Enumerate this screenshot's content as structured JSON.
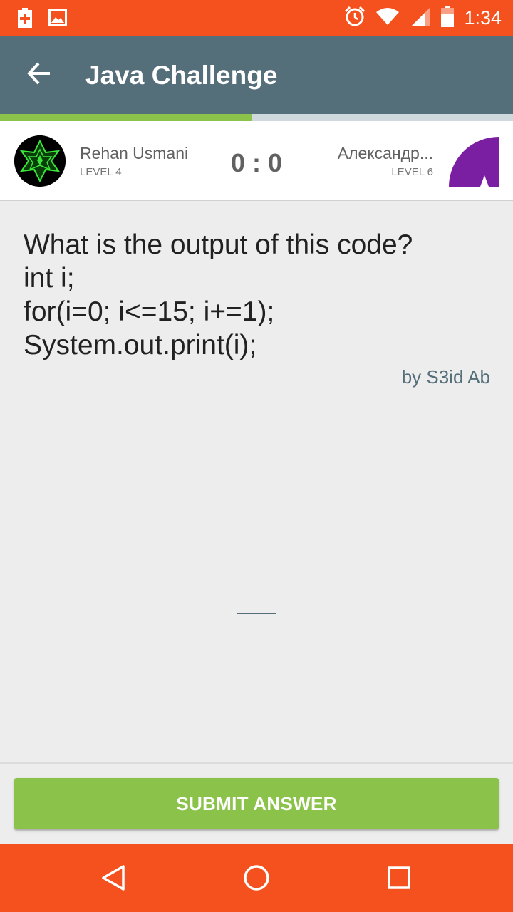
{
  "status_bar": {
    "time": "1:34",
    "icons": [
      "battery-saver-icon",
      "image-icon",
      "alarm-icon",
      "wifi-icon",
      "signal-icon",
      "battery-icon"
    ],
    "color": "#f4511e"
  },
  "app_bar": {
    "title": "Java Challenge",
    "back_icon": "arrow-back-icon",
    "color": "#546e7a"
  },
  "progress": {
    "fraction": 0.49,
    "fill_color": "#8bc34a"
  },
  "players": {
    "left": {
      "name": "Rehan Usmani",
      "level": "LEVEL 4"
    },
    "score": "0 : 0",
    "right": {
      "name": "Александр...",
      "level": "LEVEL 6",
      "avatar_letter": "A",
      "avatar_color": "#7b1fa2"
    }
  },
  "question": {
    "lines": [
      "What is the output of this code?",
      "int i;",
      "for(i=0; i<=15; i+=1);",
      "System.out.print(i);"
    ],
    "author": "by S3id Ab"
  },
  "answer": {
    "value": "",
    "placeholder": ""
  },
  "submit": {
    "label": "SUBMIT ANSWER",
    "color": "#8bc34a"
  },
  "nav_bar": {
    "icons": [
      "back-triangle-icon",
      "home-circle-icon",
      "recents-square-icon"
    ]
  }
}
